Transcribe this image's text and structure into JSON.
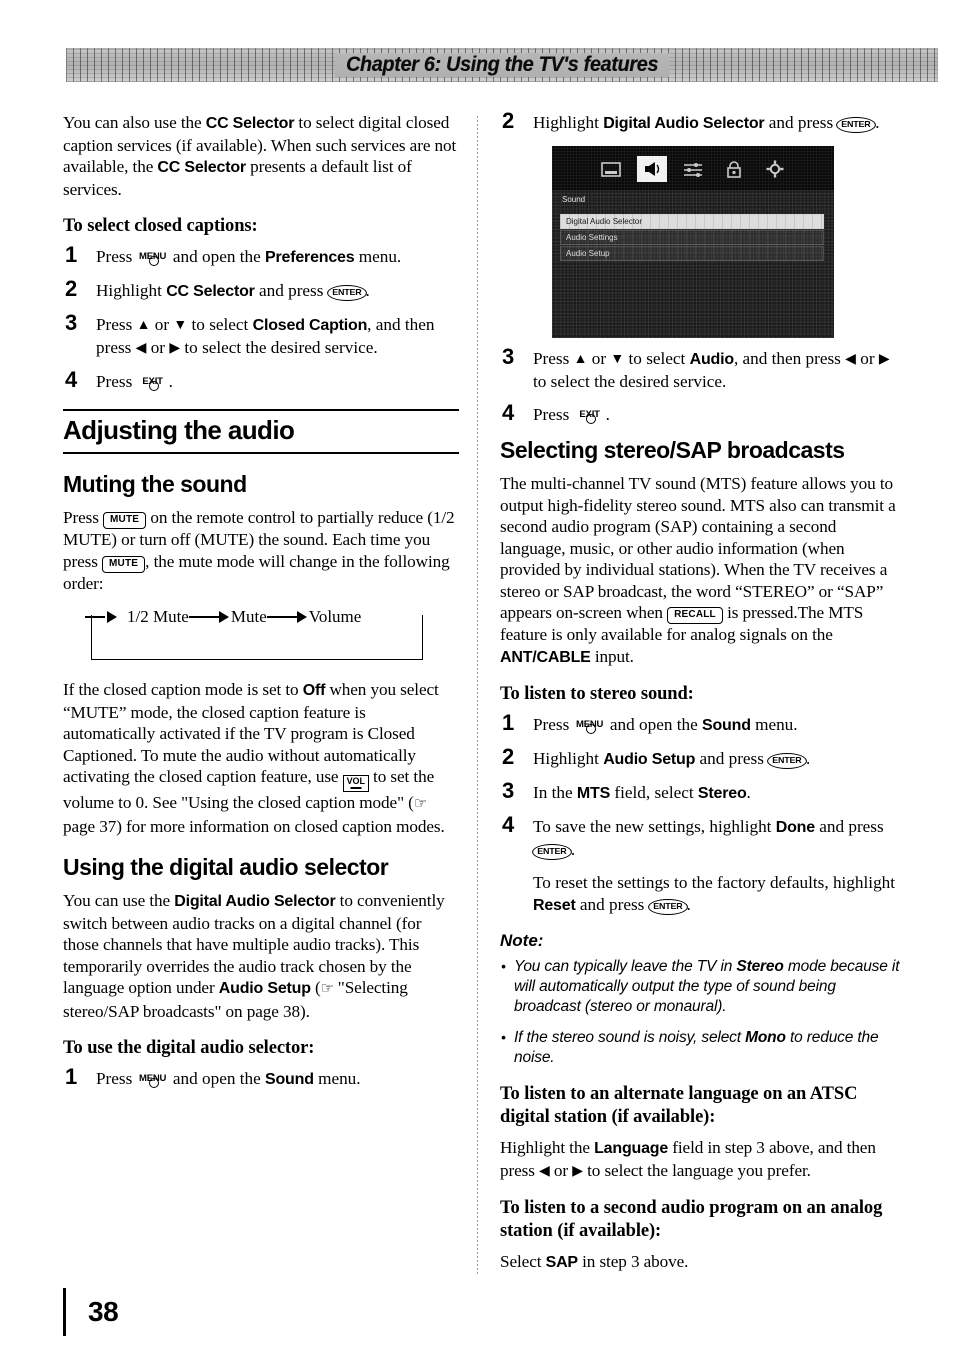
{
  "header": {
    "chapter_title": "Chapter 6: Using the TV's features"
  },
  "footer": {
    "page_number": "38"
  },
  "left_column": {
    "intro_paragraph": {
      "part1": "You can also use the ",
      "bold1": "CC Selector",
      "part2": " to select digital closed caption services (if available). When such services are not available, the ",
      "bold2": "CC Selector",
      "part3": " presents a default list of services."
    },
    "proc_heading": "To select closed captions:",
    "steps": [
      {
        "num": "1",
        "pre": "Press ",
        "key": "MENU",
        "mid": " and open the ",
        "bold": "Preferences",
        "post": " menu."
      },
      {
        "num": "2",
        "pre": "Highlight ",
        "bold": "CC Selector",
        "mid": " and press ",
        "key": "ENTER",
        "post": "."
      },
      {
        "num": "3",
        "pre": "Press ",
        "up": "▲",
        "or1": " or ",
        "down": "▼",
        "mid": " to select ",
        "bold": "Closed Caption",
        "post": ", and then press ",
        "left": "◀",
        "or2": " or ",
        "right": "▶",
        "tail": " to select the desired service."
      },
      {
        "num": "4",
        "pre": "Press ",
        "key": "EXIT",
        "post": "."
      }
    ],
    "major_heading": "Adjusting the audio",
    "mute_heading": "Muting the sound",
    "mute_paragraph": {
      "part1": "Press ",
      "key1": "MUTE",
      "part2": " on the remote control to partially reduce (1/2 MUTE) or turn off (MUTE) the sound. Each time you press ",
      "key2": "MUTE",
      "part3": ", the mute mode will change in the following order:"
    },
    "mute_cycle": [
      "1/2 Mute",
      "Mute",
      "Volume"
    ],
    "cc_paragraph": {
      "part1": "If the closed caption mode is set to ",
      "bold1": "Off",
      "part2": " when you select “MUTE” mode, the closed caption feature is automatically activated if the TV program is Closed Captioned. To mute the audio without automatically activating the closed caption feature, use ",
      "key_vol": "VOL",
      "part3": " to set the volume to 0. See \"Using the closed caption mode\" (",
      "hand": "☞",
      "part4": " page 37) for more information on closed caption modes."
    },
    "das_heading": "Using the digital audio selector",
    "das_paragraph": {
      "part1": "You can use the ",
      "bold1": "Digital Audio Selector",
      "part2": " to conveniently switch between audio tracks on a digital channel (for those channels that have multiple audio tracks). This temporarily overrides the audio track chosen by the language option under ",
      "bold2": "Audio Setup",
      "part3": " (",
      "hand": "☞",
      "part4": " \"Selecting stereo/SAP broadcasts\" on page 38)."
    },
    "das_proc_heading": "To use the digital audio selector:",
    "das_steps": [
      {
        "num": "1",
        "pre": "Press ",
        "key": "MENU",
        "mid": " and open the ",
        "bold": "Sound",
        "post": " menu."
      }
    ]
  },
  "right_column": {
    "step2": {
      "num": "2",
      "pre": "Highlight ",
      "bold": "Digital Audio Selector",
      "mid": " and press ",
      "key": "ENTER",
      "post": "."
    },
    "tv_menu": {
      "icons": [
        "picture-icon",
        "speaker-icon",
        "sliders-icon",
        "lock-icon",
        "gear-icon"
      ],
      "selected_icon_index": 1,
      "panel_title": "Sound",
      "rows": [
        {
          "label": "Digital Audio Selector",
          "highlighted": true
        },
        {
          "label": "Audio Settings",
          "highlighted": false
        },
        {
          "label": "Audio Setup",
          "highlighted": false
        }
      ]
    },
    "step3": {
      "num": "3",
      "pre": "Press ",
      "up": "▲",
      "or1": " or ",
      "down": "▼",
      "mid": " to select ",
      "bold": "Audio",
      "post": ", and then press ",
      "left": "◀",
      "or2": " or ",
      "right": "▶",
      "tail": " to select the desired service."
    },
    "step4": {
      "num": "4",
      "pre": "Press ",
      "key": "EXIT",
      "post": "."
    },
    "sap_heading": "Selecting stereo/SAP broadcasts",
    "sap_paragraph": {
      "part1": "The multi-channel TV sound (MTS) feature allows you to output high-fidelity stereo sound. MTS also can transmit a second audio program (SAP) containing a second language, music, or other audio information (when provided by individual stations). When the TV receives a stereo or SAP broadcast, the word “STEREO” or “SAP” appears on-screen when ",
      "key_recall": "RECALL",
      "part2": " is pressed.The MTS feature is only available for analog signals on the ",
      "bold1": "ANT/CABLE",
      "part3": " input."
    },
    "stereo_proc_heading": "To listen to stereo sound:",
    "stereo_steps": [
      {
        "num": "1",
        "pre": "Press ",
        "key": "MENU",
        "mid": " and open the ",
        "bold": "Sound",
        "post": " menu."
      },
      {
        "num": "2",
        "pre": "Highlight ",
        "bold": "Audio Setup",
        "mid": " and press ",
        "key": "ENTER",
        "post": "."
      },
      {
        "num": "3",
        "pre": "In the ",
        "bold": "MTS",
        "mid": " field, select ",
        "bold2": "Stereo",
        "post": "."
      },
      {
        "num": "4",
        "pre": "To save the new settings, highlight ",
        "bold": "Done",
        "mid": " and press ",
        "key": "ENTER",
        "post": "."
      }
    ],
    "reset_paragraph": {
      "part1": "To reset the settings to the factory defaults, highlight ",
      "bold1": "Reset",
      "part2": " and press ",
      "key": "ENTER",
      "part3": "."
    },
    "note_heading": "Note:",
    "notes": [
      {
        "part1": "You can typically leave the TV in ",
        "bold1": "Stereo",
        "part2": " mode because it will automatically output the type of sound being broadcast (stereo or monaural)."
      },
      {
        "part1": "If the stereo sound is noisy, select ",
        "bold1": "Mono",
        "part2": " to reduce the noise."
      }
    ],
    "lang_proc_heading": "To listen to an alternate language on an ATSC digital station (if available):",
    "lang_paragraph": {
      "part1": "Highlight the ",
      "bold1": "Language",
      "part2": " field in step 3 above, and then press ",
      "left": "◀",
      "or": " or ",
      "right": "▶",
      "part3": " to select the language you prefer."
    },
    "sap2_proc_heading": "To listen to a second audio program on an analog station (if available):",
    "sap2_paragraph": {
      "part1": "Select ",
      "bold1": "SAP",
      "part2": " in step 3 above."
    }
  }
}
